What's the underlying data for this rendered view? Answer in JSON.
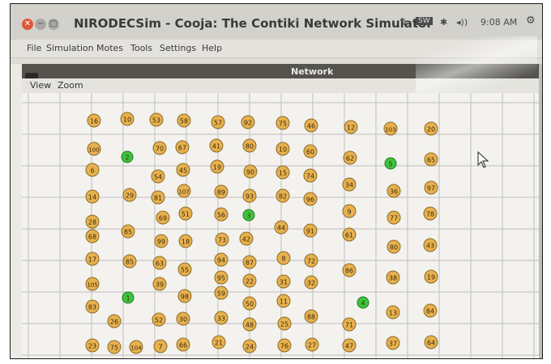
{
  "window": {
    "title": "NIRODECSim - Cooja: The Contiki Network Simulator"
  },
  "tray": {
    "network": "⇅",
    "sw": "SW",
    "bluetooth": "✱",
    "volume": "◂))",
    "time": "9:08 AM",
    "gear": "⚙"
  },
  "menubar": {
    "items": [
      "File",
      "Simulation",
      "Motes",
      "Tools",
      "Settings",
      "Help"
    ]
  },
  "network_window": {
    "title": "Network",
    "menus": [
      "View",
      "Zoom"
    ]
  },
  "colors": {
    "mote_orange": "#e7b14e",
    "mote_green": "#3fc23d",
    "grid": "#bfbfbf"
  },
  "motes": [
    {
      "label": "16",
      "type": "normal"
    },
    {
      "label": "10",
      "type": "normal"
    },
    {
      "label": "53",
      "type": "normal"
    },
    {
      "label": "58",
      "type": "normal"
    },
    {
      "label": "57",
      "type": "normal"
    },
    {
      "label": "92",
      "type": "normal"
    },
    {
      "label": "75",
      "type": "normal"
    },
    {
      "label": "46",
      "type": "normal"
    },
    {
      "label": "12",
      "type": "normal"
    },
    {
      "label": "103",
      "type": "normal"
    },
    {
      "label": "20",
      "type": "normal"
    },
    {
      "label": "100",
      "type": "normal"
    },
    {
      "label": "2",
      "type": "sink"
    },
    {
      "label": "70",
      "type": "normal"
    },
    {
      "label": "67",
      "type": "normal"
    },
    {
      "label": "41",
      "type": "normal"
    },
    {
      "label": "80",
      "type": "normal"
    },
    {
      "label": "10",
      "type": "normal"
    },
    {
      "label": "60",
      "type": "normal"
    },
    {
      "label": "62",
      "type": "normal"
    },
    {
      "label": "5",
      "type": "sink"
    },
    {
      "label": "65",
      "type": "normal"
    },
    {
      "label": "6",
      "type": "normal"
    },
    {
      "label": "54",
      "type": "normal"
    },
    {
      "label": "45",
      "type": "normal"
    },
    {
      "label": "19",
      "type": "normal"
    },
    {
      "label": "90",
      "type": "normal"
    },
    {
      "label": "15",
      "type": "normal"
    },
    {
      "label": "74",
      "type": "normal"
    },
    {
      "label": "34",
      "type": "normal"
    },
    {
      "label": "36",
      "type": "normal"
    },
    {
      "label": "97",
      "type": "normal"
    },
    {
      "label": "14",
      "type": "normal"
    },
    {
      "label": "29",
      "type": "normal"
    },
    {
      "label": "81",
      "type": "normal"
    },
    {
      "label": "107",
      "type": "normal"
    },
    {
      "label": "89",
      "type": "normal"
    },
    {
      "label": "93",
      "type": "normal"
    },
    {
      "label": "82",
      "type": "normal"
    },
    {
      "label": "96",
      "type": "normal"
    },
    {
      "label": "28",
      "type": "normal"
    },
    {
      "label": "69",
      "type": "normal"
    },
    {
      "label": "51",
      "type": "normal"
    },
    {
      "label": "56",
      "type": "normal"
    },
    {
      "label": "3",
      "type": "sink"
    },
    {
      "label": "9",
      "type": "normal"
    },
    {
      "label": "77",
      "type": "normal"
    },
    {
      "label": "78",
      "type": "normal"
    },
    {
      "label": "68",
      "type": "normal"
    },
    {
      "label": "85",
      "type": "normal"
    },
    {
      "label": "44",
      "type": "normal"
    },
    {
      "label": "91",
      "type": "normal"
    },
    {
      "label": "61",
      "type": "normal"
    },
    {
      "label": "99",
      "type": "normal"
    },
    {
      "label": "18",
      "type": "normal"
    },
    {
      "label": "73",
      "type": "normal"
    },
    {
      "label": "42",
      "type": "normal"
    },
    {
      "label": "80",
      "type": "normal"
    },
    {
      "label": "43",
      "type": "normal"
    },
    {
      "label": "17",
      "type": "normal"
    },
    {
      "label": "85",
      "type": "normal"
    },
    {
      "label": "63",
      "type": "normal"
    },
    {
      "label": "94",
      "type": "normal"
    },
    {
      "label": "87",
      "type": "normal"
    },
    {
      "label": "8",
      "type": "normal"
    },
    {
      "label": "72",
      "type": "normal"
    },
    {
      "label": "55",
      "type": "normal"
    },
    {
      "label": "86",
      "type": "normal"
    },
    {
      "label": "105",
      "type": "normal"
    },
    {
      "label": "39",
      "type": "normal"
    },
    {
      "label": "95",
      "type": "normal"
    },
    {
      "label": "22",
      "type": "normal"
    },
    {
      "label": "31",
      "type": "normal"
    },
    {
      "label": "32",
      "type": "normal"
    },
    {
      "label": "38",
      "type": "normal"
    },
    {
      "label": "19",
      "type": "normal"
    },
    {
      "label": "1",
      "type": "sink"
    },
    {
      "label": "98",
      "type": "normal"
    },
    {
      "label": "59",
      "type": "normal"
    },
    {
      "label": "50",
      "type": "normal"
    },
    {
      "label": "11",
      "type": "normal"
    },
    {
      "label": "4",
      "type": "sink"
    },
    {
      "label": "83",
      "type": "normal"
    },
    {
      "label": "13",
      "type": "normal"
    },
    {
      "label": "84",
      "type": "normal"
    },
    {
      "label": "26",
      "type": "normal"
    },
    {
      "label": "52",
      "type": "normal"
    },
    {
      "label": "30",
      "type": "normal"
    },
    {
      "label": "33",
      "type": "normal"
    },
    {
      "label": "48",
      "type": "normal"
    },
    {
      "label": "25",
      "type": "normal"
    },
    {
      "label": "88",
      "type": "normal"
    },
    {
      "label": "71",
      "type": "normal"
    },
    {
      "label": "23",
      "type": "normal"
    },
    {
      "label": "75",
      "type": "normal"
    },
    {
      "label": "104",
      "type": "normal"
    },
    {
      "label": "7",
      "type": "normal"
    },
    {
      "label": "66",
      "type": "normal"
    },
    {
      "label": "21",
      "type": "normal"
    },
    {
      "label": "24",
      "type": "normal"
    },
    {
      "label": "76",
      "type": "normal"
    },
    {
      "label": "27",
      "type": "normal"
    },
    {
      "label": "47",
      "type": "normal"
    },
    {
      "label": "37",
      "type": "normal"
    },
    {
      "label": "64",
      "type": "normal"
    }
  ]
}
